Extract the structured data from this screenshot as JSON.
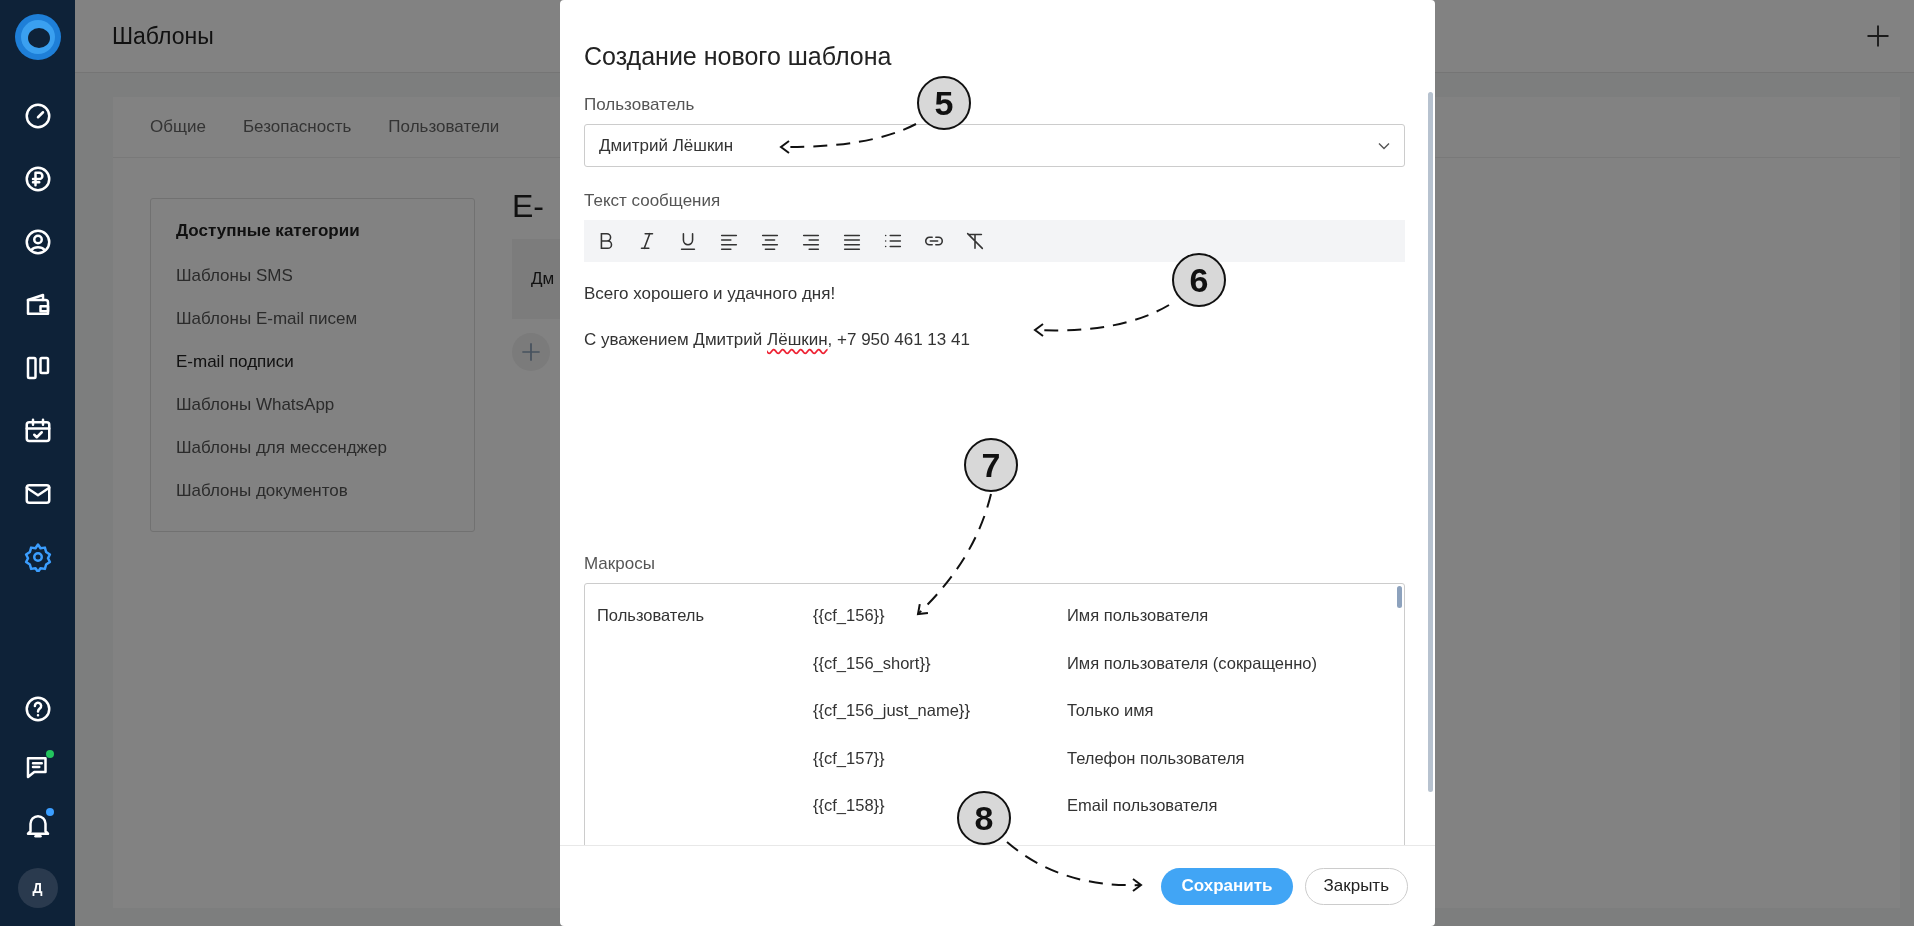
{
  "sidebar": {
    "nav": [
      {
        "selected": false
      },
      {
        "selected": false
      },
      {
        "selected": false
      },
      {
        "selected": false
      },
      {
        "selected": false
      },
      {
        "selected": false
      },
      {
        "selected": false
      },
      {
        "selected": true
      }
    ],
    "bottom": [
      {
        "badge": false
      },
      {
        "badge": true,
        "color": "#22c55e"
      },
      {
        "badge": true,
        "color": "#3b9eff"
      }
    ],
    "avatar": "Д"
  },
  "header": {
    "title": "Шаблоны"
  },
  "tabs": [
    "Общие",
    "Безопасность",
    "Пользователи"
  ],
  "categories": {
    "title": "Доступные категории",
    "items": [
      {
        "label": "Шаблоны SMS",
        "selected": false
      },
      {
        "label": "Шаблоны E-mail писем",
        "selected": false
      },
      {
        "label": "E-mail подписи",
        "selected": true
      },
      {
        "label": "Шаблоны WhatsApp",
        "selected": false
      },
      {
        "label": "Шаблоны для мессенджер",
        "selected": false
      },
      {
        "label": "Шаблоны документов",
        "selected": false
      }
    ]
  },
  "content": {
    "heading": "E-",
    "row_text": "Дм"
  },
  "modal": {
    "title": "Создание нового шаблона",
    "user_label": "Пользователь",
    "user_value": "Дмитрий Лёшкин",
    "message_label": "Текст сообщения",
    "message": [
      [
        {
          "text": "Всего хорошего и удачного дня!",
          "misspelled": false
        }
      ],
      [
        {
          "text": "С уважением Дмитрий ",
          "misspelled": false
        },
        {
          "text": "Лёшкин",
          "misspelled": true
        },
        {
          "text": ", +7 950 461 13 41",
          "misspelled": false
        }
      ]
    ],
    "macros_label": "Макросы",
    "macros": [
      {
        "group": "Пользователь",
        "code": "{{cf_156}}",
        "description": "Имя пользователя"
      },
      {
        "code": "{{cf_156_short}}",
        "description": "Имя пользователя (сокращенно)"
      },
      {
        "code": "{{cf_156_just_name}}",
        "description": "Только имя"
      },
      {
        "code": "{{cf_157}}",
        "description": "Телефон пользователя"
      },
      {
        "code": "{{cf_158}}",
        "description": "Email пользователя"
      }
    ],
    "save": "Сохранить",
    "close": "Закрыть"
  },
  "annotations": [
    "5",
    "6",
    "7",
    "8"
  ]
}
